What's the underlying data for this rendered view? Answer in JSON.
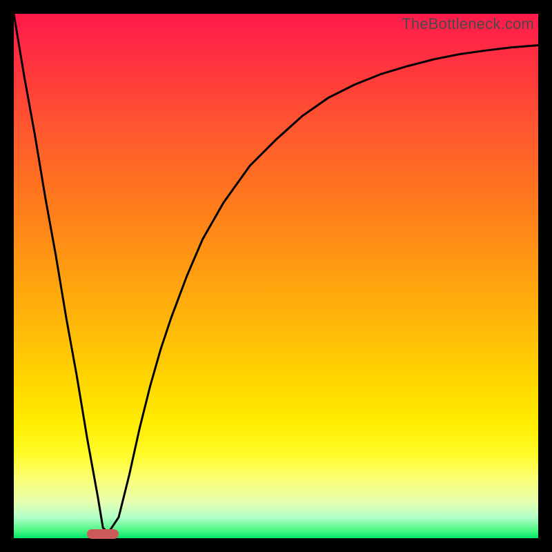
{
  "watermark": "TheBottleneck.com",
  "colors": {
    "frame": "#000000",
    "curve": "#000000",
    "marker": "#cc5a5a"
  },
  "chart_data": {
    "type": "line",
    "title": "",
    "xlabel": "",
    "ylabel": "",
    "xlim": [
      0,
      100
    ],
    "ylim": [
      0,
      100
    ],
    "grid": false,
    "legend": false,
    "marker": {
      "x_start": 14,
      "x_end": 20,
      "y": 0.8
    },
    "series": [
      {
        "name": "bottleneck-curve",
        "x": [
          0,
          2,
          4,
          6,
          8,
          10,
          12,
          14,
          16,
          17,
          18,
          20,
          22,
          24,
          26,
          28,
          30,
          33,
          36,
          40,
          45,
          50,
          55,
          60,
          65,
          70,
          75,
          80,
          85,
          90,
          95,
          100
        ],
        "y": [
          100,
          88,
          77,
          65,
          54,
          42,
          31,
          19,
          8,
          2,
          1,
          4,
          12,
          21,
          29,
          36,
          42,
          50,
          57,
          64,
          71,
          76,
          80.5,
          84,
          86.5,
          88.5,
          90,
          91.3,
          92.3,
          93,
          93.6,
          94
        ]
      }
    ],
    "background_gradient": [
      {
        "stop": 0,
        "color": "#ff1a4c"
      },
      {
        "stop": 0.32,
        "color": "#ff7020"
      },
      {
        "stop": 0.62,
        "color": "#ffbf08"
      },
      {
        "stop": 0.84,
        "color": "#fffb2a"
      },
      {
        "stop": 0.96,
        "color": "#b2ffc8"
      },
      {
        "stop": 1.0,
        "color": "#00e66a"
      }
    ]
  }
}
